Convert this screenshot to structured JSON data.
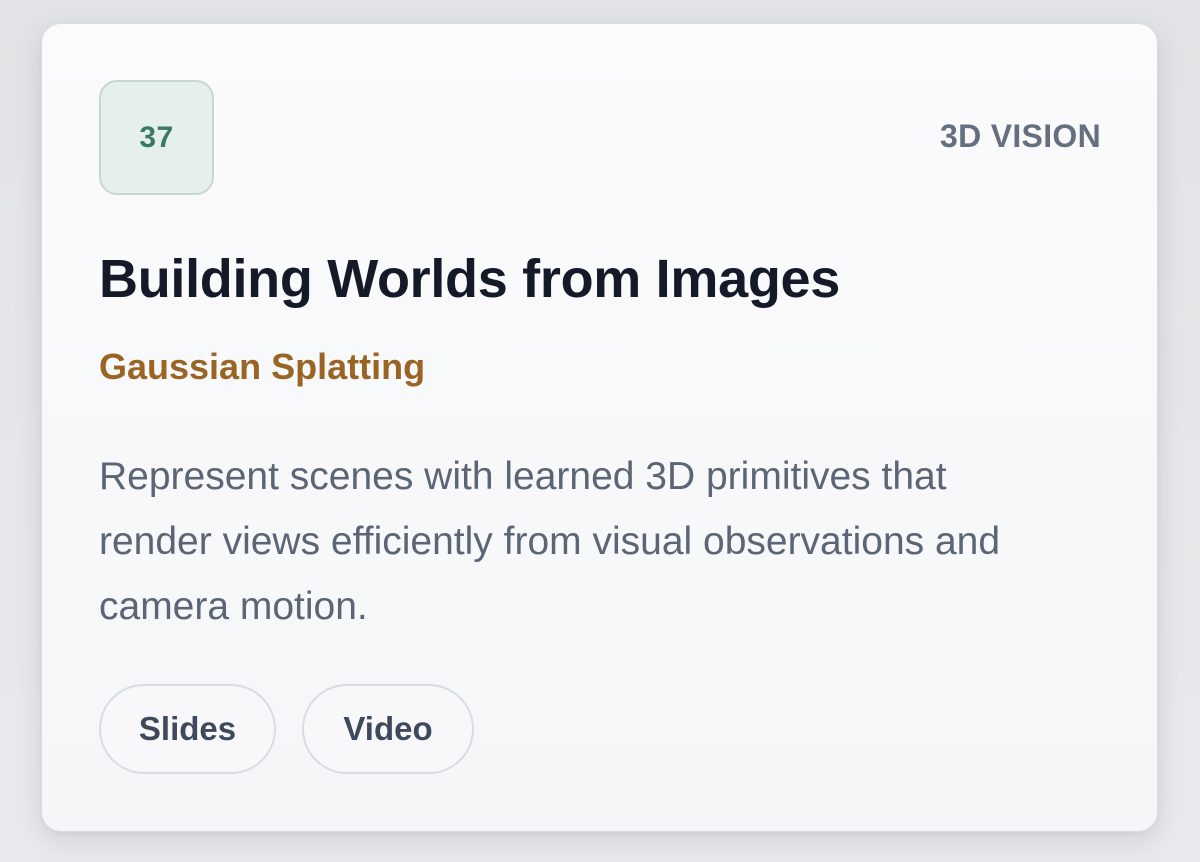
{
  "card": {
    "rank": "37",
    "category": "3D VISION",
    "title": "Building Worlds from Images",
    "subtitle": "Gaussian Splatting",
    "description": "Represent scenes with learned 3D primitives that render views efficiently from visual observations and camera motion.",
    "actions": [
      {
        "label": "Slides"
      },
      {
        "label": "Video"
      }
    ]
  },
  "colors": {
    "rank_text": "#3b7a62",
    "rank_bg": "#e5efeb",
    "category_text": "#656f7f",
    "title_text": "#141a28",
    "subtitle_text": "#9a6424",
    "description_text": "#5b6576",
    "pill_text": "#3e4a5c"
  }
}
